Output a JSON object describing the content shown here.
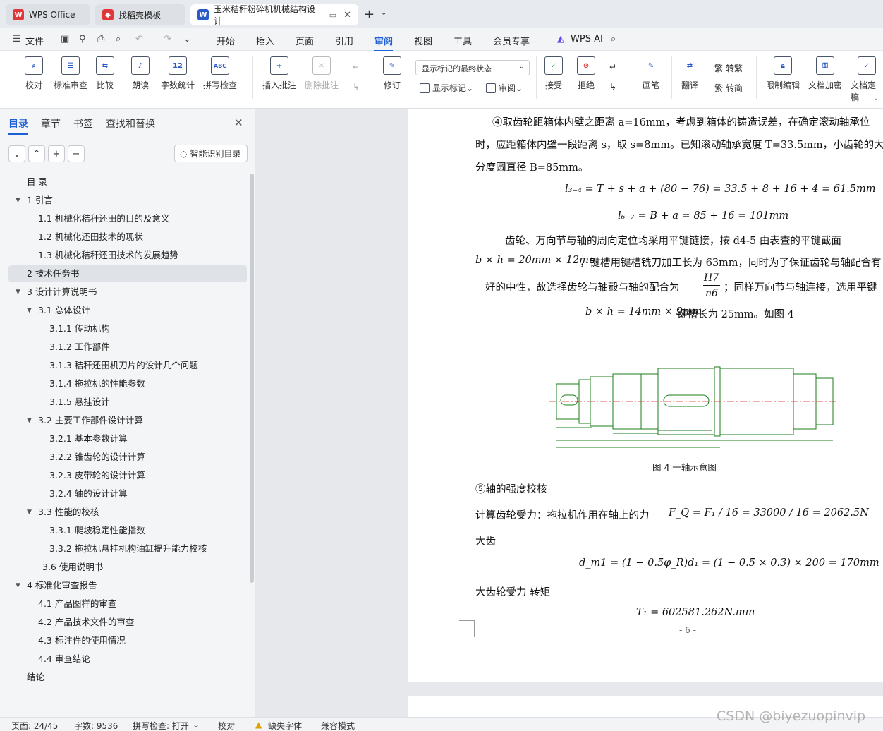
{
  "tabs": {
    "wps": "WPS Office",
    "template": "找稻壳模板",
    "document": "玉米秸秆粉碎机机械结构设计"
  },
  "menu": {
    "file": "文件",
    "items": [
      "开始",
      "插入",
      "页面",
      "引用",
      "审阅",
      "视图",
      "工具",
      "会员专享"
    ],
    "ai": "WPS AI"
  },
  "ribbon": {
    "proofread": "校对",
    "standard_review": "标准审查",
    "compare": "比较",
    "read_aloud": "朗读",
    "word_count": "字数统计",
    "spell_check": "拼写检查",
    "insert_comment": "插入批注",
    "delete_comment": "删除批注",
    "revise": "修订",
    "display_state": "显示标记的最终状态",
    "show_markup": "显示标记",
    "review": "审阅",
    "accept": "接受",
    "reject": "拒绝",
    "pen": "画笔",
    "translate": "翻译",
    "to_traditional": "转繁",
    "to_simplified": "转简",
    "restrict_edit": "限制编辑",
    "doc_encrypt": "文档加密",
    "doc_finalize": "文档定稿"
  },
  "sidebar": {
    "tabs": [
      "目录",
      "章节",
      "书签",
      "查找和替换"
    ],
    "smart_button": "智能识别目录",
    "toc": [
      {
        "text": "目 录",
        "level": 0,
        "toggle": ""
      },
      {
        "text": "1 引言",
        "level": 0,
        "toggle": "▼"
      },
      {
        "text": "1.1 机械化秸秆还田的目的及意义",
        "level": 1,
        "toggle": ""
      },
      {
        "text": "1.2 机械化还田技术的现状",
        "level": 1,
        "toggle": ""
      },
      {
        "text": "1.3 机械化秸秆还田技术的发展趋势",
        "level": 1,
        "toggle": ""
      },
      {
        "text": "2 技术任务书",
        "level": 0,
        "toggle": "",
        "selected": true
      },
      {
        "text": "3 设计计算说明书",
        "level": 0,
        "toggle": "▼"
      },
      {
        "text": "3.1 总体设计",
        "level": 1,
        "toggle": "▼"
      },
      {
        "text": "3.1.1 传动机构",
        "level": 2,
        "toggle": ""
      },
      {
        "text": "3.1.2 工作部件",
        "level": 2,
        "toggle": ""
      },
      {
        "text": "3.1.3 秸秆还田机刀片的设计几个问题",
        "level": 2,
        "toggle": ""
      },
      {
        "text": "3.1.4 拖拉机的性能参数",
        "level": 2,
        "toggle": ""
      },
      {
        "text": "3.1.5 悬挂设计",
        "level": 2,
        "toggle": ""
      },
      {
        "text": "3.2 主要工作部件设计计算",
        "level": 1,
        "toggle": "▼"
      },
      {
        "text": "3.2.1 基本参数计算",
        "level": 2,
        "toggle": ""
      },
      {
        "text": "3.2.2 锥齿轮的设计计算",
        "level": 2,
        "toggle": ""
      },
      {
        "text": "3.2.3 皮带轮的设计计算",
        "level": 2,
        "toggle": ""
      },
      {
        "text": "3.2.4 轴的设计计算",
        "level": 2,
        "toggle": ""
      },
      {
        "text": "3.3 性能的校核",
        "level": 1,
        "toggle": "▼"
      },
      {
        "text": "3.3.1 爬坡稳定性能指数",
        "level": 2,
        "toggle": ""
      },
      {
        "text": "3.3.2 拖拉机悬挂机构油缸提升能力校核",
        "level": 2,
        "toggle": ""
      },
      {
        "text": "3.6 使用说明书",
        "level": 1.5,
        "toggle": ""
      },
      {
        "text": "4 标准化审查报告",
        "level": 0,
        "toggle": "▼"
      },
      {
        "text": "4.1 产品图样的审查",
        "level": 1,
        "toggle": ""
      },
      {
        "text": "4.2 产品技术文件的审查",
        "level": 1,
        "toggle": ""
      },
      {
        "text": "4.3 标注件的使用情况",
        "level": 1,
        "toggle": ""
      },
      {
        "text": "4.4 审查结论",
        "level": 1,
        "toggle": ""
      },
      {
        "text": "结论",
        "level": 0,
        "toggle": ""
      }
    ]
  },
  "doc": {
    "p1": "④取齿轮距箱体内壁之距离 a=16mm，考虑到箱体的铸造误差，在确定滚动轴承位",
    "p2": "时，应距箱体内壁一段距离 s，取 s=8mm。已知滚动轴承宽度 T=33.5mm，小齿轮的大",
    "p3": "分度圆直径 B=85mm。",
    "eq1": "l₃₋₄ = T + s + a + (80 − 76) = 33.5 + 8 + 16 + 4 = 61.5mm",
    "eq2": "l₆₋₇ = B + a = 85 + 16 = 101mm",
    "p4": "齿轮、万向节与轴的周向定位均采用平键链接，按 d4-5 由表查的平键截面",
    "p5_math": "b × h = 20mm × 12mm",
    "p5_text": "，键槽用键槽铣刀加工长为 63mm，同时为了保证齿轮与轴配合有",
    "p6_text": "好的中性，故选择齿轮与轴毂与轴的配合为",
    "frac_num": "H7",
    "frac_den": "n6",
    "p6_tail": "；同样万向节与轴连接，选用平键",
    "p7_math": "b × h = 14mm × 9mm",
    "p7_text": " 键槽长为 25mm。如图 4",
    "fig_caption": "图 4  一轴示意图",
    "p8": "⑤轴的强度校核",
    "p9_text": "计算齿轮受力：拖拉机作用在轴上的力",
    "p9_math": "F_Q = F₁ / 16 = 33000 / 16 = 2062.5N",
    "p10": "大齿",
    "eq3": "d_m1 = (1 − 0.5φ_R)d₁ = (1 − 0.5 × 0.3) × 200 = 170mm",
    "p11": "大齿轮受力     转矩",
    "eq4": "T₁ = 602581.262N.mm",
    "page_no": "- 6 -"
  },
  "status": {
    "page": "页面: 24/45",
    "words": "字数: 9536",
    "spell": "拼写检查: 打开",
    "proof": "校对",
    "missing_font": "缺失字体",
    "compat": "兼容模式"
  },
  "watermark": "CSDN @biyezuopinvip",
  "colors": {
    "accent": "#1d5fd4",
    "wps_red": "#e0383a",
    "drawing": "#1a7f1a"
  }
}
